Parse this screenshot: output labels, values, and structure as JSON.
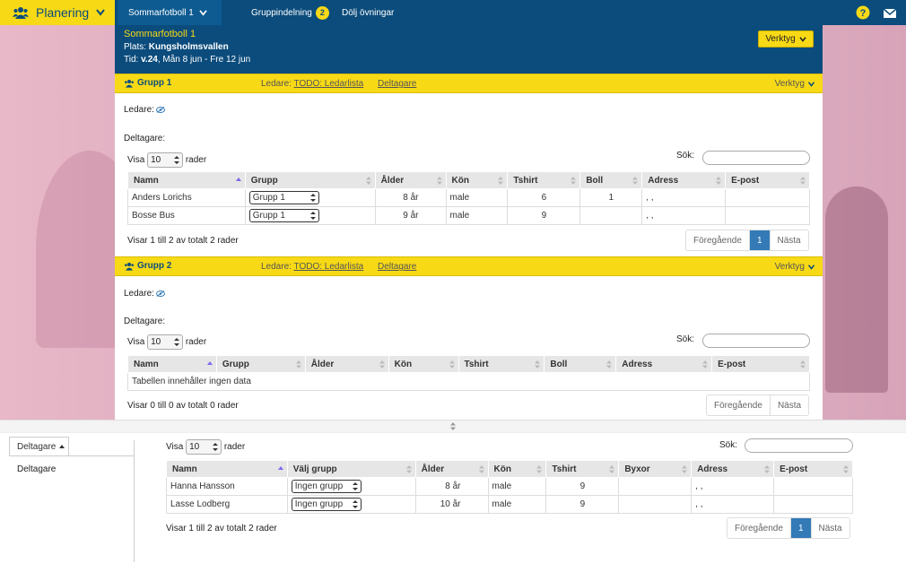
{
  "nav": {
    "brand": "Planering",
    "event_dropdown": "Sommarfotboll 1",
    "groups_link": "Gruppindelning",
    "groups_badge": "2",
    "hide_exercises": "Dölj övningar"
  },
  "event": {
    "title": "Sommarfotboll 1",
    "place_label": "Plats:",
    "place_value": "Kungsholmsvallen",
    "time_label": "Tid:",
    "time_week": "v.24",
    "time_range": ", Mån 8 jun - Fre 12 jun",
    "tools_button": "Verktyg"
  },
  "common": {
    "leader_label": "Ledare:",
    "leader_link": "TODO: Ledarlista",
    "participants_link": "Deltagare",
    "tools": "Verktyg",
    "leaders_heading": "Ledare:",
    "participants_heading": "Deltagare:",
    "show": "Visa",
    "rows": "rader",
    "page_size": "10",
    "search": "Sök:",
    "prev": "Föregående",
    "next": "Nästa",
    "page": "1"
  },
  "group1": {
    "name": "Grupp 1",
    "columns": [
      "Namn",
      "Grupp",
      "Ålder",
      "Kön",
      "Tshirt",
      "Boll",
      "Adress",
      "E-post"
    ],
    "rows": [
      {
        "name": "Anders Lorichs",
        "group": "Grupp 1",
        "age": "8 år",
        "gender": "male",
        "tshirt": "6",
        "ball": "1",
        "address": ", ,",
        "email": ""
      },
      {
        "name": "Bosse Bus",
        "group": "Grupp 1",
        "age": "9 år",
        "gender": "male",
        "tshirt": "9",
        "ball": "",
        "address": ", ,",
        "email": ""
      }
    ],
    "info": "Visar 1 till 2 av totalt 2 rader"
  },
  "group2": {
    "name": "Grupp 2",
    "columns": [
      "Namn",
      "Grupp",
      "Ålder",
      "Kön",
      "Tshirt",
      "Boll",
      "Adress",
      "E-post"
    ],
    "empty": "Tabellen innehåller ingen data",
    "info": "Visar 0 till 0 av totalt 0 rader"
  },
  "bottom": {
    "tab_label": "Deltagare",
    "side_item": "Deltagare",
    "columns": [
      "Namn",
      "Välj grupp",
      "Ålder",
      "Kön",
      "Tshirt",
      "Byxor",
      "Adress",
      "E-post"
    ],
    "rows": [
      {
        "name": "Hanna Hansson",
        "group": "Ingen grupp",
        "age": "8 år",
        "gender": "male",
        "tshirt": "9",
        "pants": "",
        "address": ", ,",
        "email": ""
      },
      {
        "name": "Lasse Lodberg",
        "group": "Ingen grupp",
        "age": "10 år",
        "gender": "male",
        "tshirt": "9",
        "pants": "",
        "address": ", ,",
        "email": ""
      }
    ],
    "info": "Visar 1 till 2 av totalt 2 rader"
  },
  "colors": {
    "navy": "#0b4c7c",
    "yellow": "#f7d916",
    "page_active": "#337ab7"
  }
}
